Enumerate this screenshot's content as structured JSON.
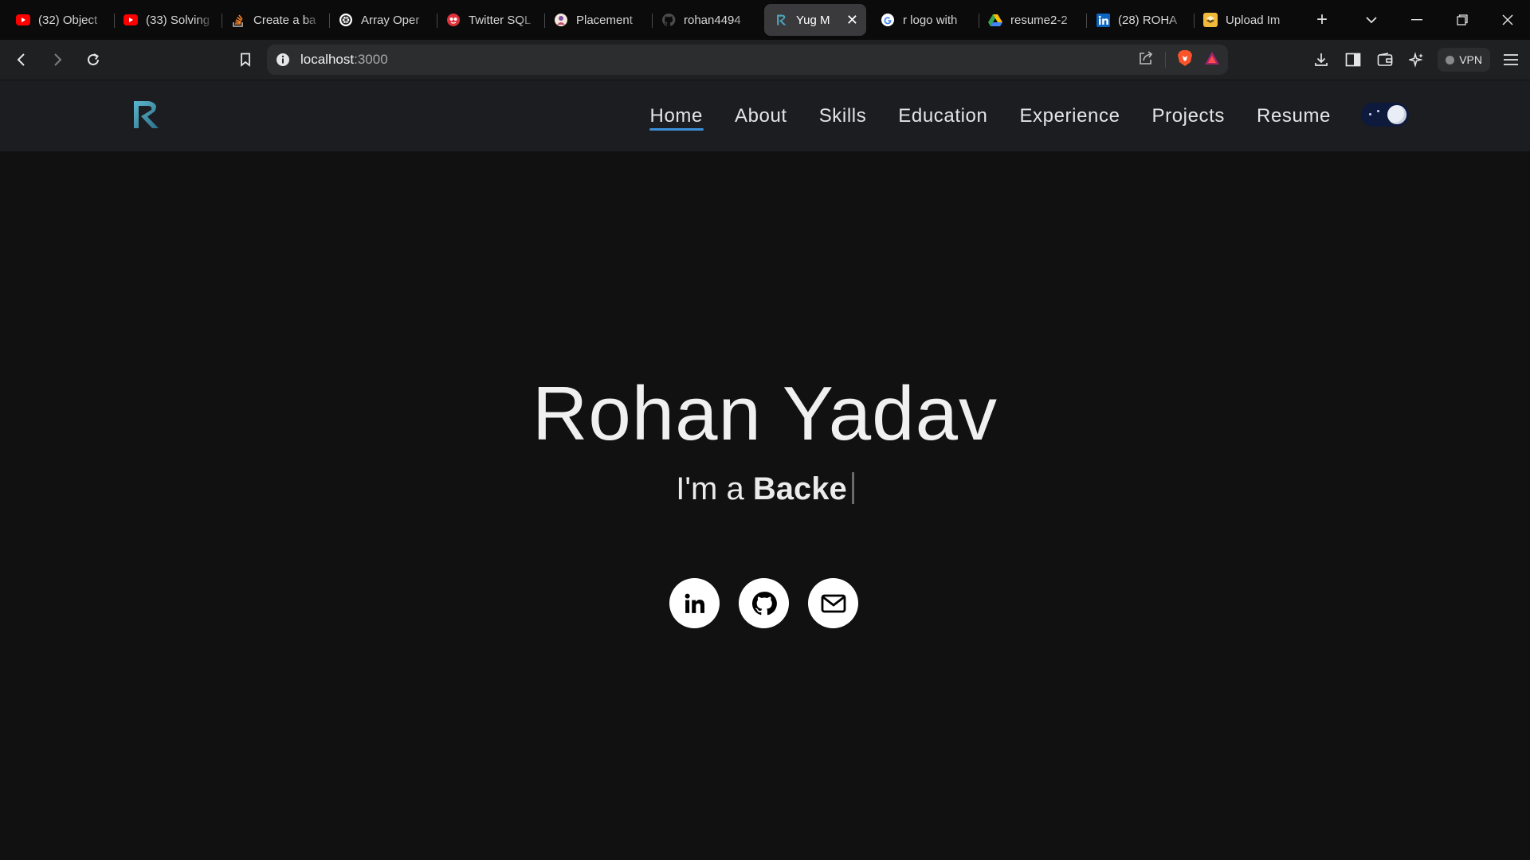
{
  "browser": {
    "tabs": [
      {
        "title": "(32) Object",
        "icon": "youtube-icon",
        "active": false
      },
      {
        "title": "(33) Solving",
        "icon": "youtube-icon",
        "active": false
      },
      {
        "title": "Create a ba",
        "icon": "stackoverflow-icon",
        "active": false
      },
      {
        "title": "Array Oper",
        "icon": "openai-icon",
        "active": false
      },
      {
        "title": "Twitter SQL",
        "icon": "twitter-sql-icon",
        "active": false
      },
      {
        "title": "Placement",
        "icon": "placement-icon",
        "active": false
      },
      {
        "title": "rohan4494",
        "icon": "github-icon",
        "active": false
      },
      {
        "title": "Yug M",
        "icon": "site-logo-icon",
        "active": true
      },
      {
        "title": "r logo with",
        "icon": "google-icon",
        "active": false
      },
      {
        "title": "resume2-2",
        "icon": "google-drive-icon",
        "active": false
      },
      {
        "title": "(28) ROHA",
        "icon": "linkedin-icon",
        "active": false
      },
      {
        "title": "Upload Im",
        "icon": "upload-icon",
        "active": false
      }
    ],
    "address": {
      "host": "localhost",
      "port": ":3000"
    },
    "vpn_label": "VPN"
  },
  "site": {
    "nav": [
      "Home",
      "About",
      "Skills",
      "Education",
      "Experience",
      "Projects",
      "Resume"
    ],
    "active_nav": "Home",
    "accent_color": "#3b8fd8",
    "hero": {
      "name": "Rohan Yadav",
      "subtitle_prefix": "I'm a ",
      "subtitle_typed": "Backe"
    },
    "socials": [
      "linkedin-icon",
      "github-icon",
      "mail-icon"
    ]
  }
}
